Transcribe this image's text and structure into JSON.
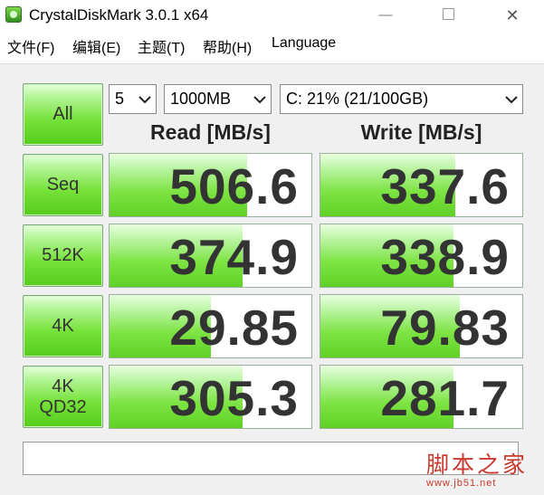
{
  "window": {
    "title": "CrystalDiskMark 3.0.1 x64",
    "minimize_label": "—",
    "close_label": "✕"
  },
  "menu": [
    "文件(F)",
    "编辑(E)",
    "主题(T)",
    "帮助(H)",
    "Language"
  ],
  "controls": {
    "all_button": "All",
    "count": "5",
    "size": "1000MB",
    "drive": "C: 21% (21/100GB)"
  },
  "headers": {
    "read": "Read [MB/s]",
    "write": "Write [MB/s]"
  },
  "tests": [
    {
      "label_line1": "Seq",
      "label_line2": "",
      "read": "506.6",
      "write": "337.6",
      "read_fill": 0.68,
      "write_fill": 0.67
    },
    {
      "label_line1": "512K",
      "label_line2": "",
      "read": "374.9",
      "write": "338.9",
      "read_fill": 0.66,
      "write_fill": 0.66
    },
    {
      "label_line1": "4K",
      "label_line2": "",
      "read": "29.85",
      "write": "79.83",
      "read_fill": 0.5,
      "write_fill": 0.69
    },
    {
      "label_line1": "4K",
      "label_line2": "QD32",
      "read": "305.3",
      "write": "281.7",
      "read_fill": 0.66,
      "write_fill": 0.66
    }
  ],
  "status_text": "",
  "watermark": {
    "main": "脚本之家",
    "url": "www.jb51.net"
  },
  "colors": {
    "accent_green": "#5fd126",
    "watermark_red": "#c9392d"
  },
  "icons": [
    "app-icon",
    "minimize-icon",
    "maximize-icon",
    "close-icon",
    "chevron-down-icon"
  ]
}
